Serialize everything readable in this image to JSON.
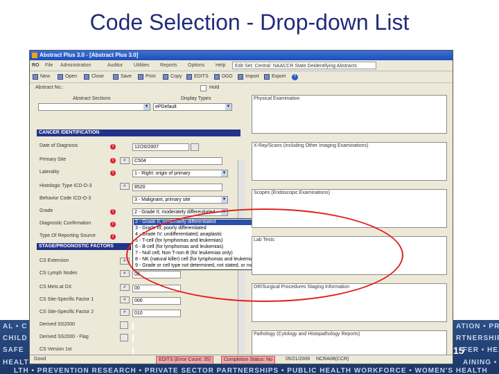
{
  "slide": {
    "title": "Code Selection - Drop-down List",
    "page_number": "15"
  },
  "footer_lines": [
    "AL • C",
    "CHILD",
    "SAFE",
    "HEALT",
    "LTH • PREVENTION RESEARCH • PRIVATE SECTOR PARTNERSHIPS • PUBLIC HEALTH WORKFORCE • WOMEN'S HEALTH",
    "ATION • PR",
    "RTNERSHIPS",
    "FER • HEA",
    "AINING • C"
  ],
  "window": {
    "title": "Abstract Plus 3.0 - [Abstract Plus 3.0]"
  },
  "menu": {
    "logo": "RO",
    "items": [
      "File",
      "Administration",
      "Auditor",
      "Utilities",
      "Reports",
      "Options",
      "Help"
    ],
    "edit_set": "Edit Set: Central: NAACCR State Deidentifying Abstracts"
  },
  "toolbar": {
    "items": [
      "New",
      "Open",
      "Close",
      "Save",
      "Print",
      "Copy",
      "EDITS",
      "DGD",
      "Import",
      "Export"
    ]
  },
  "form": {
    "abstract_no_label": "Abstract No.:",
    "hold_label": "Hold",
    "abstract_sections_label": "Abstract Sections",
    "display_types_label": "Display Types",
    "display_type_value": "ePDefault",
    "cancer_id_header": "CANCER IDENTIFICATION",
    "stage_header": "STAGE/PROGNOSTIC FACTORS",
    "fields": [
      {
        "label": "Date of Diagnosis",
        "value": "12/20/2007"
      },
      {
        "label": "Primary Site",
        "value": "C504"
      },
      {
        "label": "Laterality",
        "value": "1 - Right: origin of primary"
      },
      {
        "label": "Histologic Type ICD-O-3",
        "value": "8520"
      },
      {
        "label": "Behavior Code ICD-O-3",
        "value": "3 - Malignant, primary site"
      },
      {
        "label": "Grade",
        "value": "2 - Grade II; moderately differentiated"
      },
      {
        "label": "Diagnostic Confirmation",
        "value": ""
      },
      {
        "label": "Type Of Reporting Source",
        "value": ""
      }
    ],
    "stage_fields": [
      {
        "label": "CS Extension",
        "value": ""
      },
      {
        "label": "CS Lymph Nodes",
        "value": "00"
      },
      {
        "label": "CS Mets at DX",
        "value": "00"
      },
      {
        "label": "CS Site-Specific Factor 1",
        "value": "000"
      },
      {
        "label": "CS Site-Specific Factor 2",
        "value": "010"
      },
      {
        "label": "Derived SS2000",
        "value": ""
      },
      {
        "label": "Derived SS2000 - Flag",
        "value": ""
      },
      {
        "label": "CS Version 1st",
        "value": ""
      }
    ]
  },
  "dropdown": {
    "options": [
      "2 - Grade II; moderately differentiated",
      "3 - Grade III; poorly differentiated",
      "4 - Grade IV; undifferentiated; anaplastic",
      "5 - T-cell (for lymphomas and leukemias)",
      "6 - B-cell (for lymphomas and leukemias)",
      "7 - Null cell; Non T-non B (for leukemias only)",
      "8 - NK (natural killer) cell (for lymphomas and leukemias)",
      "9 - Grade or cell type not determined, not stated, or not applicable"
    ],
    "selected_index": 0
  },
  "notes": [
    {
      "label": "Physical Examination"
    },
    {
      "label": "X-Ray/Scans (including Other Imaging Examinations)"
    },
    {
      "label": "Scopes (Endoscopic Examinations)"
    },
    {
      "label": "Lab Tests"
    },
    {
      "label": "OR/Surgical Procedures Staging Information"
    },
    {
      "label": "Pathology (Cytology and Histopathology Reports)"
    }
  ],
  "statusbar": {
    "mode": "Good",
    "edits": "EDITS (Error Count: 35)",
    "completion": "Completion Status: No",
    "date": "05/21/2009",
    "user": "NCRA08(CCR)"
  },
  "annotation_color": "#e02020"
}
